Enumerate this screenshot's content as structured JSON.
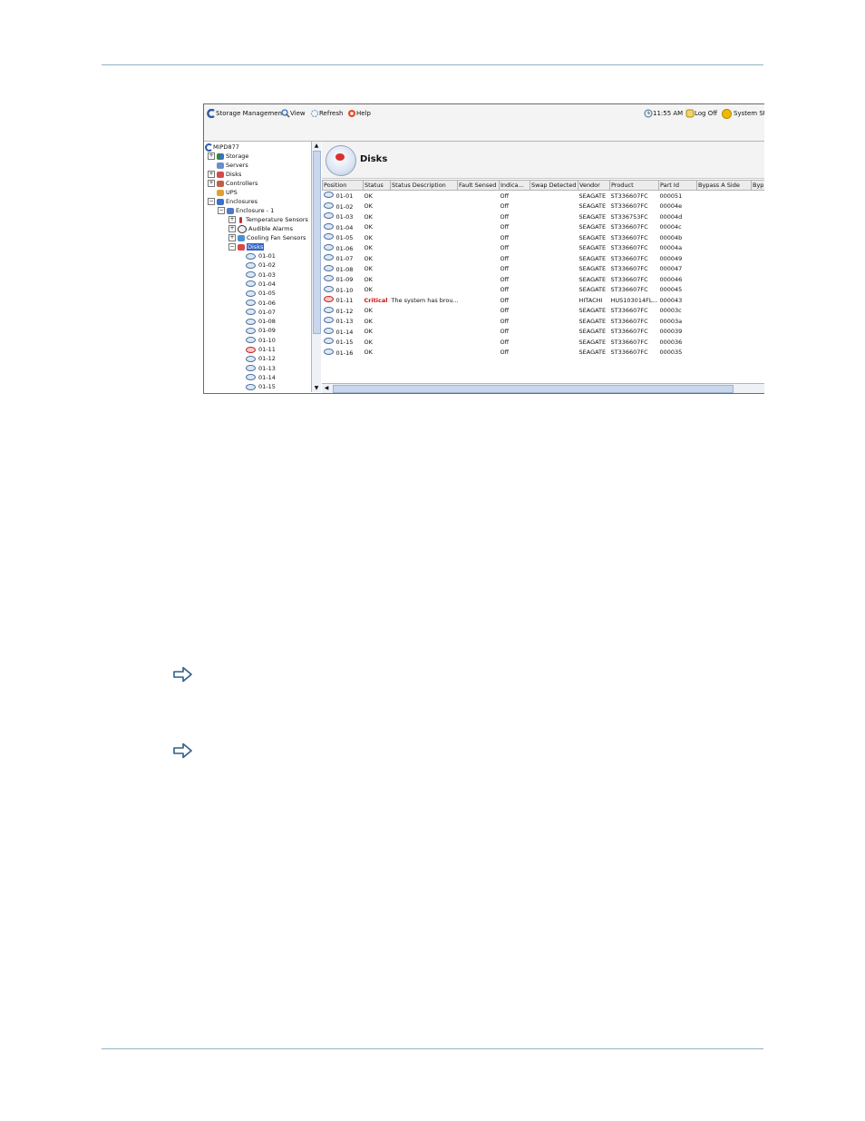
{
  "toolbar": {
    "storage_management": "Storage Management",
    "view": "View",
    "refresh": "Refresh",
    "help": "Help",
    "time": "11:55 AM",
    "log_off": "Log Off",
    "system_status": "System Sta"
  },
  "tree": {
    "root": "MIPD877",
    "storage": "Storage",
    "servers": "Servers",
    "disks": "Disks",
    "controllers": "Controllers",
    "ups": "UPS",
    "enclosures": "Enclosures",
    "enclosure1": "Enclosure - 1",
    "temperature_sensors": "Temperature Sensors",
    "audible_alarms": "Audible Alarms",
    "cooling_fan_sensors": "Cooling Fan Sensors",
    "disks_node": "Disks",
    "disk_items": [
      "01-01",
      "01-02",
      "01-03",
      "01-04",
      "01-05",
      "01-06",
      "01-07",
      "01-08",
      "01-09",
      "01-10",
      "01-11",
      "01-12",
      "01-13",
      "01-14",
      "01-15"
    ]
  },
  "panel": {
    "title": "Disks",
    "columns": [
      "Position",
      "Status",
      "Status Description",
      "Fault Sensed",
      "Indica...",
      "Swap Detected",
      "Vendor",
      "Product",
      "Part Id",
      "Bypass A Side",
      "Byp"
    ],
    "rows": [
      {
        "position": "01-01",
        "status": "OK",
        "desc": "",
        "fault": "",
        "indicator": "Off",
        "swap": "",
        "vendor": "SEAGATE",
        "product": "ST336607FC",
        "part": "000051",
        "critical": false
      },
      {
        "position": "01-02",
        "status": "OK",
        "desc": "",
        "fault": "",
        "indicator": "Off",
        "swap": "",
        "vendor": "SEAGATE",
        "product": "ST336607FC",
        "part": "00004e",
        "critical": false
      },
      {
        "position": "01-03",
        "status": "OK",
        "desc": "",
        "fault": "",
        "indicator": "Off",
        "swap": "",
        "vendor": "SEAGATE",
        "product": "ST336753FC",
        "part": "00004d",
        "critical": false
      },
      {
        "position": "01-04",
        "status": "OK",
        "desc": "",
        "fault": "",
        "indicator": "Off",
        "swap": "",
        "vendor": "SEAGATE",
        "product": "ST336607FC",
        "part": "00004c",
        "critical": false
      },
      {
        "position": "01-05",
        "status": "OK",
        "desc": "",
        "fault": "",
        "indicator": "Off",
        "swap": "",
        "vendor": "SEAGATE",
        "product": "ST336607FC",
        "part": "00004b",
        "critical": false
      },
      {
        "position": "01-06",
        "status": "OK",
        "desc": "",
        "fault": "",
        "indicator": "Off",
        "swap": "",
        "vendor": "SEAGATE",
        "product": "ST336607FC",
        "part": "00004a",
        "critical": false
      },
      {
        "position": "01-07",
        "status": "OK",
        "desc": "",
        "fault": "",
        "indicator": "Off",
        "swap": "",
        "vendor": "SEAGATE",
        "product": "ST336607FC",
        "part": "000049",
        "critical": false
      },
      {
        "position": "01-08",
        "status": "OK",
        "desc": "",
        "fault": "",
        "indicator": "Off",
        "swap": "",
        "vendor": "SEAGATE",
        "product": "ST336607FC",
        "part": "000047",
        "critical": false
      },
      {
        "position": "01-09",
        "status": "OK",
        "desc": "",
        "fault": "",
        "indicator": "Off",
        "swap": "",
        "vendor": "SEAGATE",
        "product": "ST336607FC",
        "part": "000046",
        "critical": false
      },
      {
        "position": "01-10",
        "status": "OK",
        "desc": "",
        "fault": "",
        "indicator": "Off",
        "swap": "",
        "vendor": "SEAGATE",
        "product": "ST336607FC",
        "part": "000045",
        "critical": false
      },
      {
        "position": "01-11",
        "status": "Critical",
        "desc": "The system has brou...",
        "fault": "",
        "indicator": "Off",
        "swap": "",
        "vendor": "HITACHI",
        "product": "HUS103014FL...",
        "part": "000043",
        "critical": true
      },
      {
        "position": "01-12",
        "status": "OK",
        "desc": "",
        "fault": "",
        "indicator": "Off",
        "swap": "",
        "vendor": "SEAGATE",
        "product": "ST336607FC",
        "part": "00003c",
        "critical": false
      },
      {
        "position": "01-13",
        "status": "OK",
        "desc": "",
        "fault": "",
        "indicator": "Off",
        "swap": "",
        "vendor": "SEAGATE",
        "product": "ST336607FC",
        "part": "00003a",
        "critical": false
      },
      {
        "position": "01-14",
        "status": "OK",
        "desc": "",
        "fault": "",
        "indicator": "Off",
        "swap": "",
        "vendor": "SEAGATE",
        "product": "ST336607FC",
        "part": "000039",
        "critical": false
      },
      {
        "position": "01-15",
        "status": "OK",
        "desc": "",
        "fault": "",
        "indicator": "Off",
        "swap": "",
        "vendor": "SEAGATE",
        "product": "ST336607FC",
        "part": "000036",
        "critical": false
      },
      {
        "position": "01-16",
        "status": "OK",
        "desc": "",
        "fault": "",
        "indicator": "Off",
        "swap": "",
        "vendor": "SEAGATE",
        "product": "ST336607FC",
        "part": "000035",
        "critical": false
      }
    ]
  },
  "colors": {
    "critical": "#cc1010",
    "selection": "#3164c8",
    "rule": "#8fb3c4",
    "arrow": "#2f5f86"
  }
}
